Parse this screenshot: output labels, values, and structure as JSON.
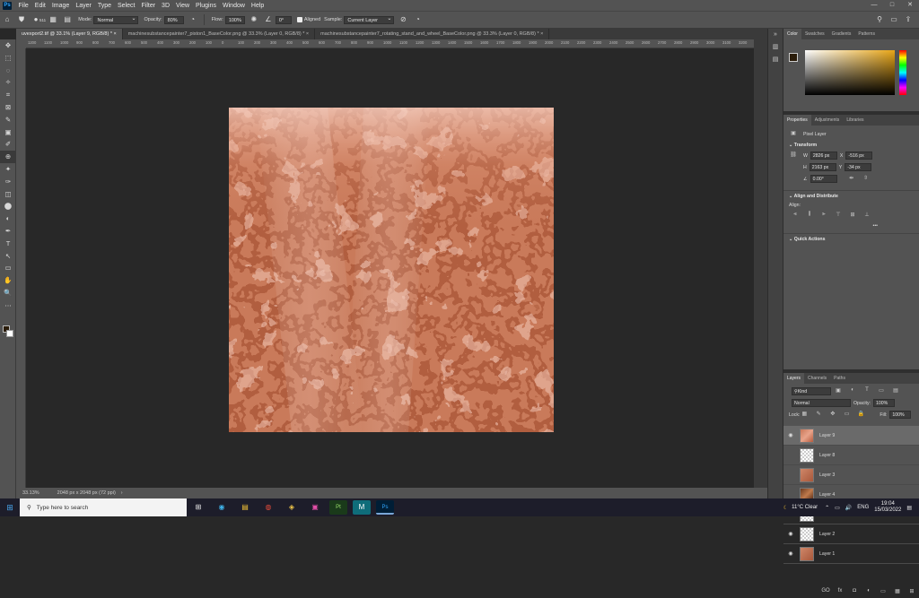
{
  "menubar": {
    "logo": "Ps",
    "items": [
      "File",
      "Edit",
      "Image",
      "Layer",
      "Type",
      "Select",
      "Filter",
      "3D",
      "View",
      "Plugins",
      "Window",
      "Help"
    ],
    "window_controls": [
      "—",
      "□",
      "✕"
    ]
  },
  "options": {
    "brush_size": "511",
    "mode_label": "Mode:",
    "mode_value": "Normal",
    "opacity_label": "Opacity:",
    "opacity_value": "80%",
    "flow_label": "Flow:",
    "flow_value": "100%",
    "angle_value": "0°",
    "aligned_label": "Aligned",
    "sample_label": "Sample:",
    "sample_value": "Current Layer"
  },
  "tabs": [
    "uvexport2.tif @ 33.1% (Layer 9, RGB/8) * ×",
    "machinesubstancepainter7_piston1_BaseColor.png @ 33.3% (Layer 0, RGB/8) * ×",
    "machinesubstancepainter7_rotating_stand_and_wheel_BaseColor.png @ 33.3% (Layer 0, RGB/8) * ×"
  ],
  "ruler_labels": [
    "1200",
    "1100",
    "1000",
    "900",
    "800",
    "700",
    "600",
    "500",
    "400",
    "300",
    "200",
    "100",
    "0",
    "100",
    "200",
    "300",
    "400",
    "500",
    "600",
    "700",
    "800",
    "900",
    "1000",
    "1100",
    "1200",
    "1300",
    "1400",
    "1500",
    "1600",
    "1700",
    "1800",
    "1900",
    "2000",
    "2100",
    "2200",
    "2300",
    "2400",
    "2500",
    "2600",
    "2700",
    "2800",
    "2900",
    "3000",
    "3100",
    "3200"
  ],
  "toolbar": [
    "✥",
    "⬚",
    "◌",
    "✧",
    "⌗",
    "⊠",
    "✎",
    "▣",
    "✐",
    "⊕",
    "✦",
    "✑",
    "◫",
    "⬤",
    "◐",
    "✒",
    "T",
    "↖",
    "▭",
    "✋",
    "🔍",
    "⋯"
  ],
  "status": {
    "zoom": "33.13%",
    "doc": "2048 px x 2048 px (72 ppi)"
  },
  "panels": {
    "color_tabs": [
      "Color",
      "Swatches",
      "Gradients",
      "Patterns"
    ],
    "props_tabs": [
      "Properties",
      "Adjustments",
      "Libraries"
    ],
    "pixel_layer": "Pixel Layer",
    "transform_title": "Transform",
    "w_label": "W",
    "w_value": "2826 px",
    "h_label": "H",
    "h_value": "2163 px",
    "x_label": "X",
    "x_value": "-516 px",
    "y_label": "Y",
    "y_value": "-34 px",
    "angle": "0.00°",
    "align_title": "Align and Distribute",
    "align_label": "Align:",
    "quick_actions": "Quick Actions",
    "layers_tabs": [
      "Layers",
      "Channels",
      "Paths"
    ],
    "kind": "Kind",
    "blend": "Normal",
    "opacity_label": "Opacity:",
    "opacity": "100%",
    "lock_label": "Lock:",
    "fill_label": "Fill:",
    "fill": "100%",
    "layers": [
      {
        "name": "Layer 9",
        "visible": true,
        "thumb": "copper",
        "selected": true
      },
      {
        "name": "Layer 8",
        "visible": false,
        "thumb": "checker",
        "selected": false
      },
      {
        "name": "Layer 3",
        "visible": false,
        "thumb": "rust",
        "selected": false
      },
      {
        "name": "Layer 4",
        "visible": false,
        "thumb": "brown",
        "selected": false
      },
      {
        "name": "Layer 5",
        "visible": true,
        "thumb": "checker",
        "selected": false
      },
      {
        "name": "Layer 2",
        "visible": true,
        "thumb": "checker",
        "selected": false
      },
      {
        "name": "Layer 1",
        "visible": true,
        "thumb": "rust",
        "selected": false
      }
    ],
    "bottom_icons": [
      "GO",
      "fx",
      "◘",
      "◐",
      "▭",
      "▦",
      "⊞",
      "🗑"
    ]
  },
  "taskbar": {
    "search_placeholder": "Type here to search",
    "apps": [
      "⊞",
      "◉",
      "▤",
      "◍",
      "◈",
      "▣",
      "Pt",
      "M",
      "Ps"
    ],
    "weather": "11°C Clear",
    "time": "19:04",
    "date": "15/03/2022",
    "lang": "ENG"
  },
  "colors": {
    "ui_bg": "#535353",
    "canvas_bg": "#282828",
    "copper": "#c97a5a",
    "fg_color": "#2a1c0a"
  }
}
